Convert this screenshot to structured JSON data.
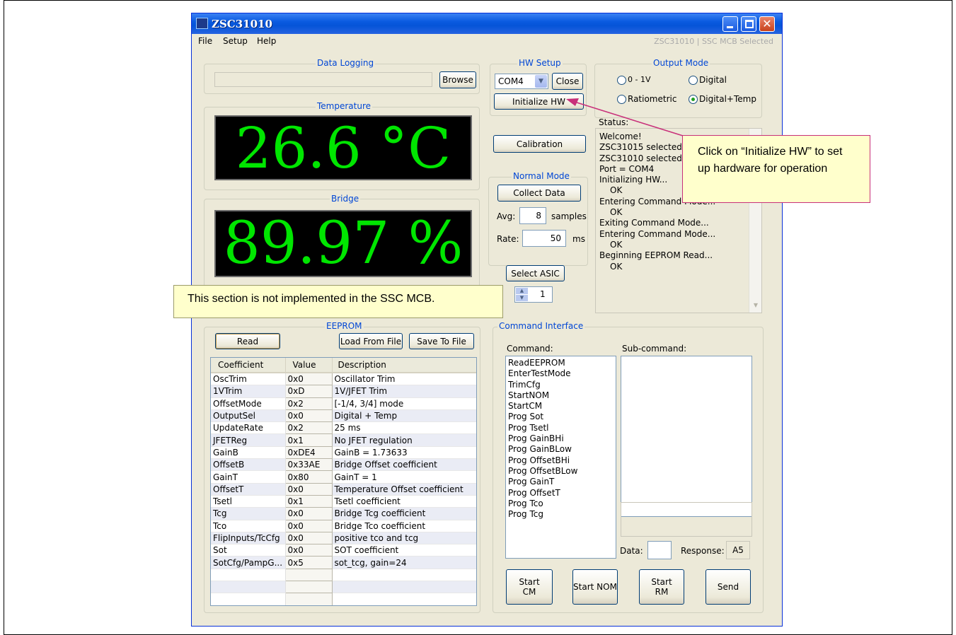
{
  "window": {
    "title": "ZSC31010",
    "subtitle": "ZSC31010 | SSC MCB Selected"
  },
  "menu": {
    "file": "File",
    "setup": "Setup",
    "help": "Help"
  },
  "data_logging": {
    "legend": "Data Logging",
    "path": "",
    "browse": "Browse"
  },
  "temperature": {
    "legend": "Temperature",
    "value": "26.6 °C"
  },
  "bridge": {
    "legend": "Bridge",
    "value": "89.97 %"
  },
  "hw_setup": {
    "legend": "HW Setup",
    "port": "COM4",
    "close": "Close",
    "initialize": "Initialize HW"
  },
  "output_mode": {
    "legend": "Output Mode",
    "options": [
      "0 - 1V",
      "Digital",
      "Ratiometric",
      "Digital+Temp"
    ],
    "selected": "Digital+Temp"
  },
  "calibration": {
    "label": "Calibration"
  },
  "normal_mode": {
    "legend": "Normal Mode",
    "collect": "Collect Data",
    "avg_label": "Avg:",
    "avg_value": "8",
    "avg_unit": "samples",
    "rate_label": "Rate:",
    "rate_value": "50",
    "rate_unit": "ms"
  },
  "asic": {
    "select": "Select ASIC",
    "value": "1"
  },
  "status": {
    "label": "Status:",
    "lines": [
      "Welcome!",
      "ZSC31015 selected",
      "ZSC31010 selected",
      "Port = COM4",
      "Initializing HW...",
      "   OK",
      "Entering Command Mode...",
      "   OK",
      "Exiting Command Mode...",
      "Entering Command Mode...",
      "   OK",
      "Beginning EEPROM Read...",
      "   OK"
    ]
  },
  "eeprom": {
    "legend": "EEPROM",
    "read": "Read",
    "load": "Load From File",
    "save": "Save To File",
    "headers": [
      "Coefficient",
      "Value",
      "Description"
    ],
    "rows": [
      [
        "OscTrim",
        "0x0",
        "Oscillator Trim"
      ],
      [
        "1VTrim",
        "0xD",
        "1V/JFET Trim"
      ],
      [
        "OffsetMode",
        "0x2",
        "[-1/4, 3/4] mode"
      ],
      [
        "OutputSel",
        "0x0",
        "Digital + Temp"
      ],
      [
        "UpdateRate",
        "0x2",
        "25 ms"
      ],
      [
        "JFETReg",
        "0x1",
        "No JFET regulation"
      ],
      [
        "GainB",
        "0xDE4",
        "GainB = 1.73633"
      ],
      [
        "OffsetB",
        "0x33AE",
        "Bridge Offset coefficient"
      ],
      [
        "GainT",
        "0x80",
        "GainT = 1"
      ],
      [
        "OffsetT",
        "0x0",
        "Temperature Offset coefficient"
      ],
      [
        "Tsetl",
        "0x1",
        "Tsetl coefficient"
      ],
      [
        "Tcg",
        "0x0",
        "Bridge Tcg coefficient"
      ],
      [
        "Tco",
        "0x0",
        "Bridge Tco coefficient"
      ],
      [
        "FlipInputs/TcCfg",
        "0x0",
        "positive tco and tcg"
      ],
      [
        "Sot",
        "0x0",
        "SOT coefficient"
      ],
      [
        "SotCfg/PampG...",
        "0x5",
        "sot_tcg, gain=24"
      ]
    ]
  },
  "command": {
    "legend": "Command Interface",
    "command_label": "Command:",
    "subcommand_label": "Sub-command:",
    "items": [
      "ReadEEPROM",
      "EnterTestMode",
      "TrimCfg",
      "StartNOM",
      "StartCM",
      "Prog Sot",
      "Prog Tsetl",
      "Prog GainBHi",
      "Prog GainBLow",
      "Prog OffsetBHi",
      "Prog OffsetBLow",
      "Prog GainT",
      "Prog OffsetT",
      "Prog Tco",
      "Prog Tcg"
    ],
    "data_label": "Data:",
    "data_value": "",
    "response_label": "Response:",
    "response_value": "A5",
    "start_cm": "Start\nCM",
    "start_nom": "Start NOM",
    "start_rm": "Start\nRM",
    "send": "Send"
  },
  "callouts": {
    "init": "Click on “Initialize HW” to set up hardware for operation",
    "not_implemented": "This section is not implemented in the SSC MCB."
  },
  "colors": {
    "display_text": "#00e600",
    "legend_text": "#0046d5",
    "callout_border": "#c8307a"
  }
}
